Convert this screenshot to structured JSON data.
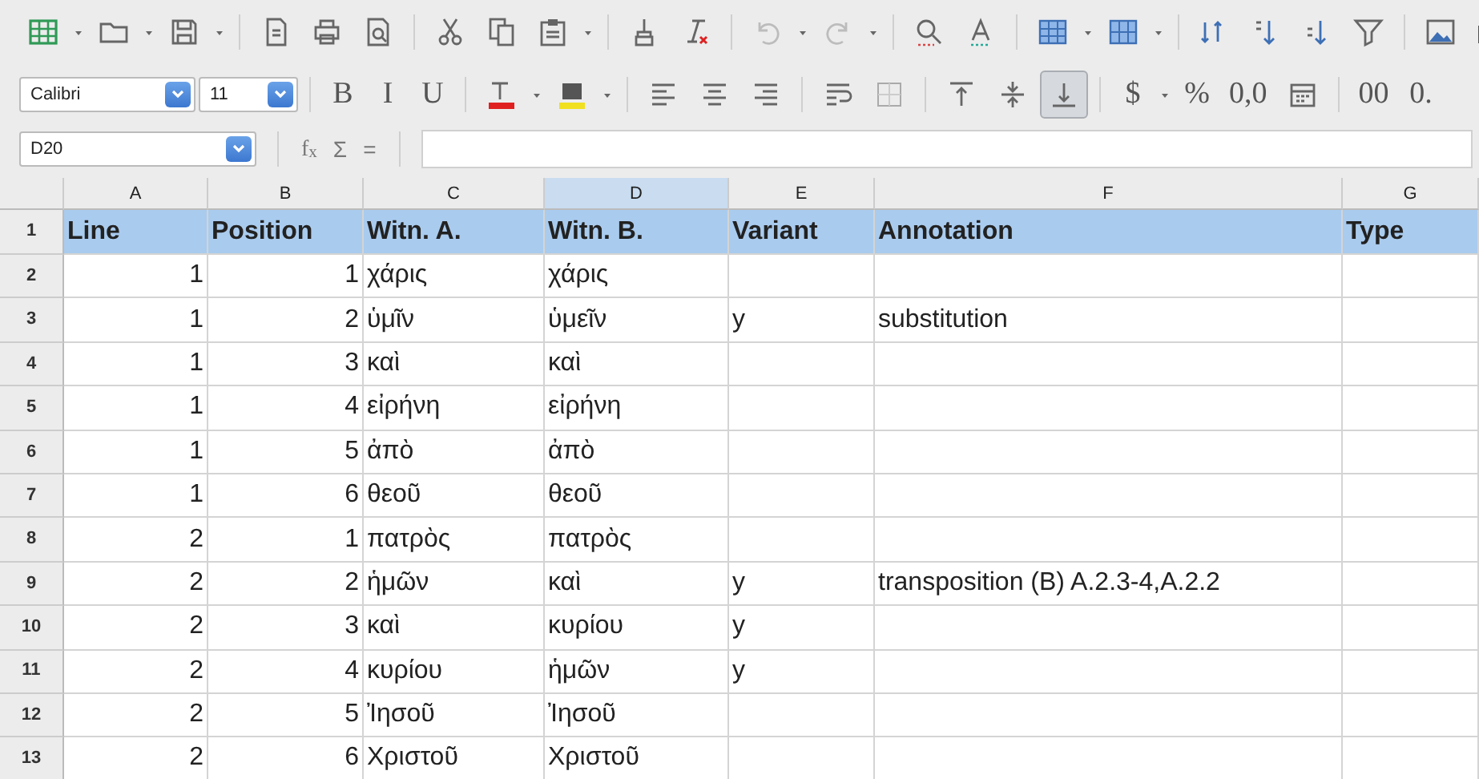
{
  "toolbar_1": [
    {
      "kind": "icon",
      "dropdown": true
    },
    {
      "kind": "icon",
      "dropdown": true
    },
    {
      "kind": "icon",
      "dropdown": true
    },
    {
      "kind": "separator"
    },
    {
      "kind": "icon"
    },
    {
      "kind": "icon"
    },
    {
      "kind": "icon"
    },
    {
      "kind": "separator"
    },
    {
      "kind": "icon"
    },
    {
      "kind": "icon"
    },
    {
      "kind": "icon",
      "dropdown": true
    },
    {
      "kind": "separator"
    },
    {
      "kind": "icon"
    },
    {
      "kind": "icon"
    },
    {
      "kind": "separator"
    },
    {
      "kind": "icon",
      "dropdown": true,
      "disabled": true
    },
    {
      "kind": "icon",
      "dropdown": true,
      "disabled": true
    },
    {
      "kind": "separator"
    },
    {
      "kind": "icon"
    },
    {
      "kind": "icon"
    },
    {
      "kind": "separator"
    },
    {
      "kind": "icon",
      "dropdown": true
    },
    {
      "kind": "icon",
      "dropdown": true
    },
    {
      "kind": "separator"
    },
    {
      "kind": "icon"
    },
    {
      "kind": "icon"
    },
    {
      "kind": "icon"
    },
    {
      "kind": "icon"
    },
    {
      "kind": "separator"
    },
    {
      "kind": "icon"
    },
    {
      "kind": "icon"
    }
  ],
  "toolbar_2": [
    {
      "kind": "combo",
      "value": "Calibri"
    },
    {
      "kind": "combo",
      "value": "11"
    },
    {
      "kind": "separator"
    },
    {
      "kind": "text",
      "label": "B"
    },
    {
      "kind": "text",
      "label": "I"
    },
    {
      "kind": "text",
      "label": "U"
    },
    {
      "kind": "separator"
    },
    {
      "kind": "icon",
      "dropdown": true,
      "color": "#e02020"
    },
    {
      "kind": "icon",
      "dropdown": true,
      "color": "#f0e020"
    },
    {
      "kind": "separator"
    },
    {
      "kind": "icon",
      "selected": false
    },
    {
      "kind": "icon",
      "selected": false
    },
    {
      "kind": "icon",
      "selected": false
    },
    {
      "kind": "separator"
    },
    {
      "kind": "icon",
      "selected": false
    },
    {
      "kind": "icon",
      "selected": false
    },
    {
      "kind": "separator"
    },
    {
      "kind": "icon",
      "selected": false
    },
    {
      "kind": "icon",
      "selected": false
    },
    {
      "kind": "icon",
      "selected": true
    },
    {
      "kind": "separator"
    },
    {
      "kind": "text",
      "label": "$",
      "dropdown": true
    },
    {
      "kind": "text",
      "label": "%"
    },
    {
      "kind": "text",
      "label": "0,0"
    },
    {
      "kind": "icon"
    },
    {
      "kind": "separator"
    },
    {
      "kind": "text",
      "label": "00"
    },
    {
      "kind": "text",
      "label": "0."
    }
  ],
  "formula_bar": {
    "name_box": "D20",
    "function_wizard": "f$_{x}$",
    "sum": "Σ",
    "equals": "="
  },
  "columns": [
    {
      "letter": "A",
      "selected": false
    },
    {
      "letter": "B",
      "selected": false
    },
    {
      "letter": "C",
      "selected": false
    },
    {
      "letter": "D",
      "selected": true
    },
    {
      "letter": "E",
      "selected": false
    },
    {
      "letter": "F",
      "selected": false
    },
    {
      "letter": "G",
      "selected": false
    }
  ],
  "rows": [
    {
      "number": "1",
      "kind": "header",
      "cells": [
        "Line",
        "Position",
        "Witn. A.",
        "Witn. B.",
        "Variant",
        "Annotation",
        "Type"
      ]
    },
    {
      "number": "2",
      "kind": "data",
      "cells": [
        "1",
        "1",
        "χάρις",
        "χάρις"
      ]
    },
    {
      "number": "3",
      "kind": "data",
      "cells": [
        "1",
        "2",
        "ὑμῖν",
        "ὑμεῖν",
        "y",
        "substitution"
      ]
    },
    {
      "number": "4",
      "kind": "data",
      "cells": [
        "1",
        "3",
        "καὶ",
        "καὶ"
      ]
    },
    {
      "number": "5",
      "kind": "data",
      "cells": [
        "1",
        "4",
        "εἰρήνη",
        "εἰρήνη"
      ]
    },
    {
      "number": "6",
      "kind": "data",
      "cells": [
        "1",
        "5",
        "ἀπὸ",
        "ἀπὸ"
      ]
    },
    {
      "number": "7",
      "kind": "data",
      "cells": [
        "1",
        "6",
        "θεοῦ",
        "θεοῦ"
      ]
    },
    {
      "number": "8",
      "kind": "data",
      "cells": [
        "2",
        "1",
        "πατρὸς",
        "πατρὸς"
      ]
    },
    {
      "number": "9",
      "kind": "data",
      "cells": [
        "2",
        "2",
        "ἡμῶν",
        "καὶ",
        "y",
        "transposition (B) A.2.3-4,A.2.2"
      ]
    },
    {
      "number": "10",
      "kind": "data",
      "cells": [
        "2",
        "3",
        "καὶ",
        "κυρίου",
        "y"
      ]
    },
    {
      "number": "11",
      "kind": "data",
      "cells": [
        "2",
        "4",
        "κυρίου",
        "ἡμῶν",
        "y"
      ]
    },
    {
      "number": "12",
      "kind": "data",
      "cells": [
        "2",
        "5",
        "Ἰησοῦ",
        "Ἰησοῦ"
      ]
    },
    {
      "number": "13",
      "kind": "data",
      "cells": [
        "2",
        "6",
        "Χριστοῦ",
        "Χριστοῦ"
      ]
    }
  ]
}
